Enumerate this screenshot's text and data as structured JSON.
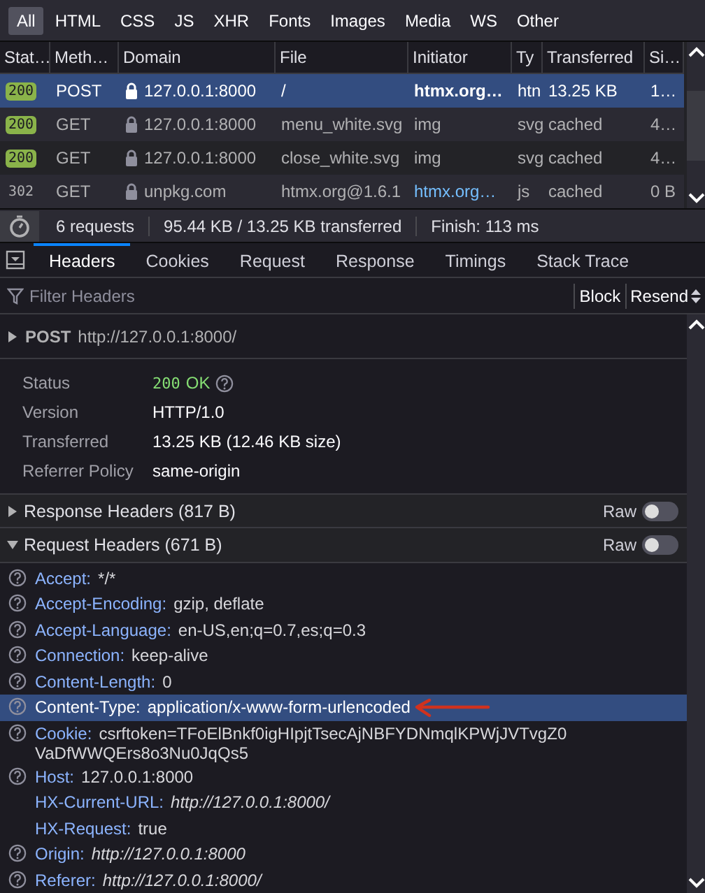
{
  "type_filters": [
    {
      "label": "All",
      "selected": true
    },
    {
      "label": "HTML",
      "selected": false
    },
    {
      "label": "CSS",
      "selected": false
    },
    {
      "label": "JS",
      "selected": false
    },
    {
      "label": "XHR",
      "selected": false
    },
    {
      "label": "Fonts",
      "selected": false
    },
    {
      "label": "Images",
      "selected": false
    },
    {
      "label": "Media",
      "selected": false
    },
    {
      "label": "WS",
      "selected": false
    },
    {
      "label": "Other",
      "selected": false
    }
  ],
  "table": {
    "columns": [
      "Stat…",
      "Meth…",
      "Domain",
      "File",
      "Initiator",
      "Ty",
      "Transferred",
      "Si…"
    ],
    "rows": [
      {
        "status": "200",
        "kind": "ok",
        "method": "POST",
        "secure": true,
        "domain": "127.0.0.1:8000",
        "file": "/",
        "initiator": "htmx.org…",
        "initiator_link": false,
        "type": "htn",
        "transferred": "13.25 KB",
        "size": "1…",
        "selected": true
      },
      {
        "status": "200",
        "kind": "ok",
        "method": "GET",
        "secure": true,
        "domain": "127.0.0.1:8000",
        "file": "menu_white.svg",
        "initiator": "img",
        "initiator_link": false,
        "type": "svg",
        "transferred": "cached",
        "size": "4…",
        "selected": false
      },
      {
        "status": "200",
        "kind": "ok",
        "method": "GET",
        "secure": true,
        "domain": "127.0.0.1:8000",
        "file": "close_white.svg",
        "initiator": "img",
        "initiator_link": false,
        "type": "svg",
        "transferred": "cached",
        "size": "4…",
        "selected": false
      },
      {
        "status": "302",
        "kind": "redirect",
        "method": "GET",
        "secure": true,
        "domain": "unpkg.com",
        "file": "htmx.org@1.6.1",
        "initiator": "htmx.org…",
        "initiator_link": true,
        "type": "js",
        "transferred": "cached",
        "size": "0 B",
        "selected": false
      }
    ]
  },
  "summary": [
    "6 requests",
    "95.44 KB / 13.25 KB transferred",
    "Finish: 113 ms"
  ],
  "detail_tabs": [
    {
      "label": "Headers",
      "selected": true
    },
    {
      "label": "Cookies",
      "selected": false
    },
    {
      "label": "Request",
      "selected": false
    },
    {
      "label": "Response",
      "selected": false
    },
    {
      "label": "Timings",
      "selected": false
    },
    {
      "label": "Stack Trace",
      "selected": false
    }
  ],
  "filter": {
    "placeholder": "Filter Headers"
  },
  "actions": [
    "Block",
    "Resend"
  ],
  "request_line": {
    "method": "POST",
    "url": "http://127.0.0.1:8000/"
  },
  "info": [
    {
      "kind": "status",
      "label": "Status",
      "code": "200",
      "value": "OK"
    },
    {
      "kind": "plain",
      "label": "Version",
      "value": "HTTP/1.0"
    },
    {
      "kind": "plain",
      "label": "Transferred",
      "value": "13.25 KB (12.46 KB size)"
    },
    {
      "kind": "plain",
      "label": "Referrer Policy",
      "value": "same-origin"
    }
  ],
  "sections": [
    {
      "title": "Response Headers (817 B)",
      "expanded": false,
      "toggle_label": "Raw",
      "raw_on": false
    },
    {
      "title": "Request Headers (671 B)",
      "expanded": true,
      "toggle_label": "Raw",
      "raw_on": false
    }
  ],
  "request_headers": [
    {
      "name": "Accept:",
      "value": "*/*",
      "help": true,
      "italic": false,
      "selected": false,
      "annotated": false
    },
    {
      "name": "Accept-Encoding:",
      "value": "gzip, deflate",
      "help": true,
      "italic": false,
      "selected": false,
      "annotated": false
    },
    {
      "name": "Accept-Language:",
      "value": "en-US,en;q=0.7,es;q=0.3",
      "help": true,
      "italic": false,
      "selected": false,
      "annotated": false
    },
    {
      "name": "Connection:",
      "value": "keep-alive",
      "help": true,
      "italic": false,
      "selected": false,
      "annotated": false
    },
    {
      "name": "Content-Length:",
      "value": "0",
      "help": true,
      "italic": false,
      "selected": false,
      "annotated": false
    },
    {
      "name": "Content-Type:",
      "value": "application/x-www-form-urlencoded",
      "help": true,
      "italic": false,
      "selected": true,
      "annotated": true
    },
    {
      "name": "Cookie:",
      "value": "csrftoken=TFoElBnkf0igHIpjtTsecAjNBFYDNmqlKPWjJVTvgZ0VaDfWWQErs8o3Nu0JqQs5",
      "help": true,
      "italic": false,
      "selected": false,
      "annotated": false
    },
    {
      "name": "Host:",
      "value": "127.0.0.1:8000",
      "help": true,
      "italic": false,
      "selected": false,
      "annotated": false
    },
    {
      "name": "HX-Current-URL:",
      "value": "http://127.0.0.1:8000/",
      "help": false,
      "italic": true,
      "selected": false,
      "annotated": false
    },
    {
      "name": "HX-Request:",
      "value": "true",
      "help": false,
      "italic": false,
      "selected": false,
      "annotated": false
    },
    {
      "name": "Origin:",
      "value": "http://127.0.0.1:8000",
      "help": true,
      "italic": true,
      "selected": false,
      "annotated": false
    },
    {
      "name": "Referer:",
      "value": "http://127.0.0.1:8000/",
      "help": true,
      "italic": true,
      "selected": false,
      "annotated": false
    }
  ]
}
